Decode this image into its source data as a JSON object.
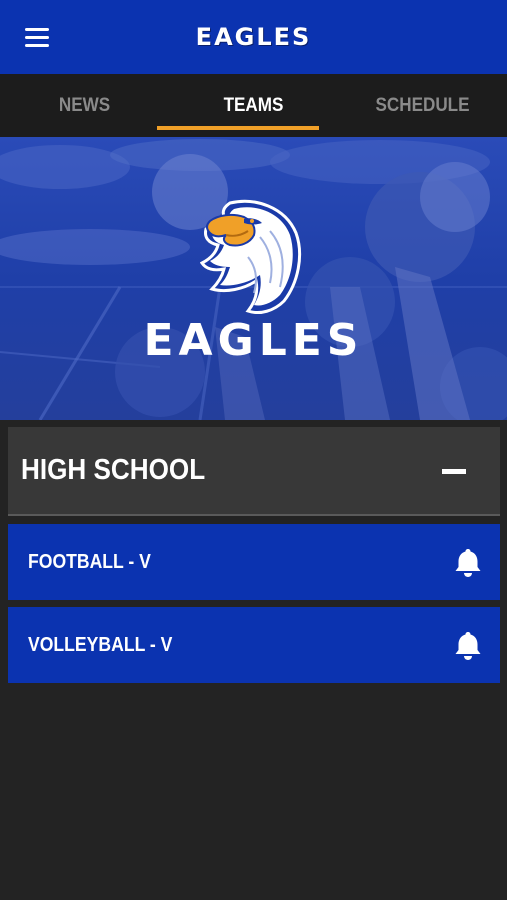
{
  "header": {
    "title": "EAGLES",
    "menu_icon": "hamburger-menu-icon"
  },
  "tabs": [
    {
      "label": "NEWS",
      "active": false
    },
    {
      "label": "TEAMS",
      "active": true
    },
    {
      "label": "SCHEDULE",
      "active": false
    }
  ],
  "hero": {
    "wordmark": "EAGLES",
    "logo_icon": "eagle-head-logo"
  },
  "section": {
    "title": "HIGH SCHOOL",
    "expanded": true,
    "toggle_icon": "minus-icon"
  },
  "teams": [
    {
      "label": "FOOTBALL - V",
      "icon": "bell-icon"
    },
    {
      "label": "VOLLEYBALL - V",
      "icon": "bell-icon"
    }
  ],
  "colors": {
    "primary_blue": "#0b33b0",
    "accent_orange": "#f0a028",
    "background": "#232323",
    "section_bg": "#383838"
  }
}
